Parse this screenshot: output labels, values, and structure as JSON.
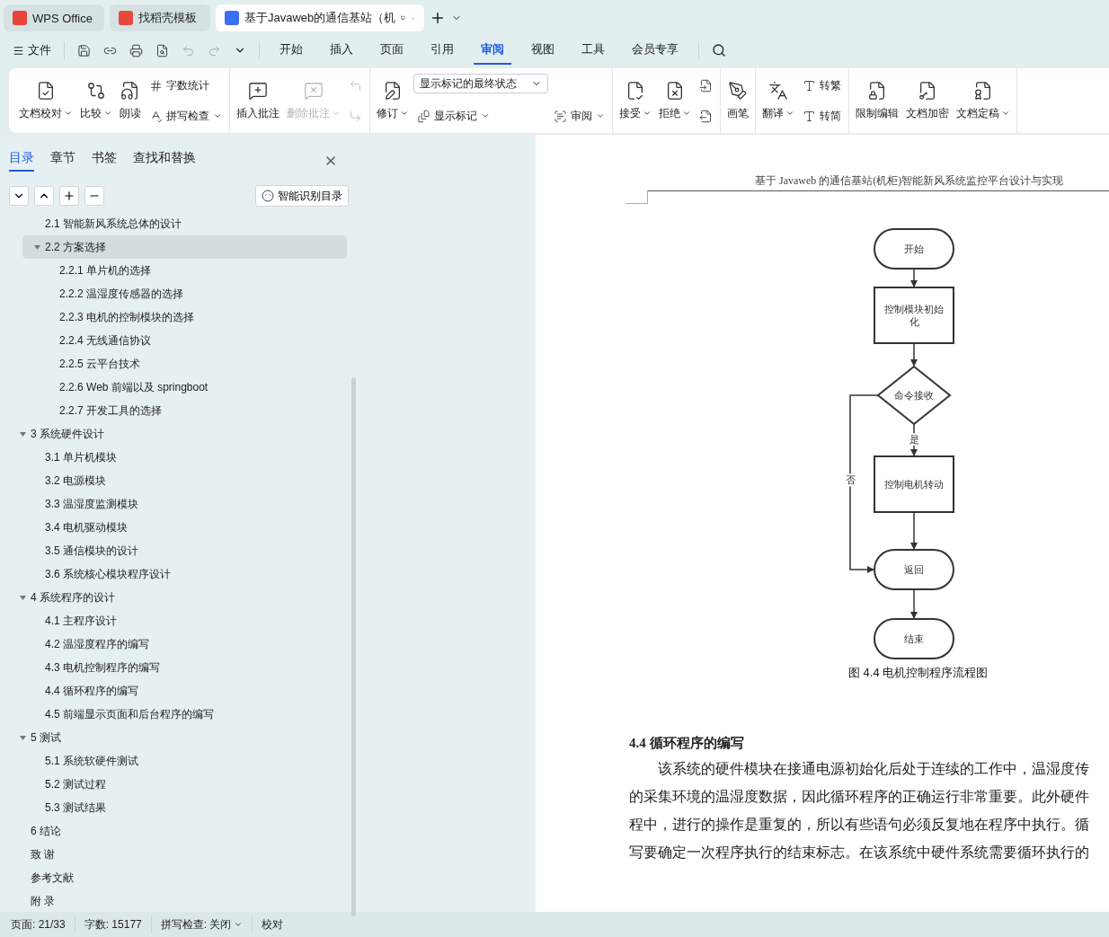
{
  "app_tabs": [
    {
      "label": "WPS Office",
      "selected": false
    },
    {
      "label": "找稻壳模板",
      "selected": false
    },
    {
      "label": "基于Javaweb的通信基站（机",
      "selected": true
    }
  ],
  "menu": {
    "file": "文件",
    "tabs": [
      {
        "label": "开始",
        "selected": false
      },
      {
        "label": "插入",
        "selected": false
      },
      {
        "label": "页面",
        "selected": false
      },
      {
        "label": "引用",
        "selected": false
      },
      {
        "label": "审阅",
        "selected": true
      },
      {
        "label": "视图",
        "selected": false
      },
      {
        "label": "工具",
        "selected": false
      },
      {
        "label": "会员专享",
        "selected": false
      }
    ]
  },
  "ribbon": [
    {
      "columns": [
        [
          {
            "kind": "large",
            "label": "文档校对",
            "dropdown": true,
            "disabled": false
          }
        ],
        [
          {
            "kind": "large",
            "label": "比较",
            "dropdown": true,
            "disabled": false
          }
        ],
        [
          {
            "kind": "large",
            "label": "朗读",
            "dropdown": false,
            "disabled": false
          }
        ],
        [
          {
            "kind": "small",
            "label": "字数统计",
            "dropdown": false,
            "disabled": false
          },
          {
            "kind": "small",
            "label": "拼写检查",
            "dropdown": true,
            "disabled": false
          }
        ]
      ]
    },
    {
      "columns": [
        [
          {
            "kind": "large",
            "label": "插入批注",
            "dropdown": false,
            "disabled": false
          }
        ],
        [
          {
            "kind": "large",
            "label": "删除批注",
            "dropdown": true,
            "disabled": true
          }
        ],
        [
          {
            "kind": "icon",
            "disabled": true
          },
          {
            "kind": "icon",
            "disabled": true
          }
        ]
      ]
    },
    {
      "columns": [
        [
          {
            "kind": "large",
            "label": "修订",
            "dropdown": true,
            "disabled": false
          }
        ],
        [
          {
            "kind": "select",
            "value": "显示标记的最终状态"
          },
          {
            "kind": "small",
            "label": "显示标记",
            "dropdown": true,
            "disabled": false
          }
        ],
        [
          {
            "kind": "spacer"
          },
          {
            "kind": "small",
            "label": "审阅",
            "dropdown": true,
            "disabled": false
          }
        ]
      ]
    },
    {
      "columns": [
        [
          {
            "kind": "large",
            "label": "接受",
            "dropdown": true,
            "disabled": false
          }
        ],
        [
          {
            "kind": "large",
            "label": "拒绝",
            "dropdown": true,
            "disabled": false
          }
        ],
        [
          {
            "kind": "icon",
            "disabled": false
          },
          {
            "kind": "icon",
            "disabled": false
          }
        ]
      ]
    },
    {
      "columns": [
        [
          {
            "kind": "large",
            "label": "画笔",
            "dropdown": false,
            "disabled": false
          }
        ]
      ]
    },
    {
      "columns": [
        [
          {
            "kind": "large",
            "label": "翻译",
            "dropdown": true,
            "disabled": false
          }
        ],
        [
          {
            "kind": "small",
            "label": "转繁",
            "dropdown": false,
            "disabled": false
          },
          {
            "kind": "small",
            "label": "转简",
            "dropdown": false,
            "disabled": false
          }
        ]
      ]
    },
    {
      "columns": [
        [
          {
            "kind": "large",
            "label": "限制编辑",
            "dropdown": false,
            "disabled": false
          }
        ],
        [
          {
            "kind": "large",
            "label": "文档加密",
            "dropdown": false,
            "disabled": false
          }
        ],
        [
          {
            "kind": "large",
            "label": "文档定稿",
            "dropdown": true,
            "disabled": false
          }
        ]
      ]
    }
  ],
  "nav_panel": {
    "tabs": [
      {
        "label": "目录",
        "selected": true
      },
      {
        "label": "章节",
        "selected": false
      },
      {
        "label": "书签",
        "selected": false
      },
      {
        "label": "查找和替换",
        "selected": false
      }
    ],
    "smart_button": "智能识别目录",
    "toc_continued": [
      {
        "label": "2.1  智能新风系统总体的设计",
        "selected": false
      },
      {
        "label": "2.2  方案选择",
        "selected": true,
        "expanded": true,
        "children": [
          {
            "label": "2.2.1  单片机的选择",
            "selected": false
          },
          {
            "label": "2.2.2  温湿度传感器的选择",
            "selected": false
          },
          {
            "label": "2.2.3  电机的控制模块的选择",
            "selected": false
          },
          {
            "label": "2.2.4  无线通信协议",
            "selected": false
          },
          {
            "label": "2.2.5 云平台技术",
            "selected": false
          },
          {
            "label": "2.2.6 Web 前端以及 springboot",
            "selected": false
          },
          {
            "label": "2.2.7  开发工具的选择",
            "selected": false
          }
        ]
      }
    ],
    "toc": [
      {
        "label": "3  系统硬件设计",
        "selected": false,
        "expanded": true,
        "children": [
          {
            "label": "3.1  单片机模块",
            "selected": false
          },
          {
            "label": "3.2  电源模块",
            "selected": false
          },
          {
            "label": "3.3  温湿度监测模块",
            "selected": false
          },
          {
            "label": "3.4  电机驱动模块",
            "selected": false
          },
          {
            "label": "3.5  通信模块的设计",
            "selected": false
          },
          {
            "label": "3.6  系统核心模块程序设计",
            "selected": false
          }
        ]
      },
      {
        "label": "4  系统程序的设计",
        "selected": false,
        "expanded": true,
        "children": [
          {
            "label": "4.1  主程序设计",
            "selected": false
          },
          {
            "label": "4.2  温湿度程序的编写",
            "selected": false
          },
          {
            "label": "4.3  电机控制程序的编写",
            "selected": false
          },
          {
            "label": "4.4  循环程序的编写",
            "selected": false
          },
          {
            "label": "4.5  前端显示页面和后台程序的编写",
            "selected": false
          }
        ]
      },
      {
        "label": "5  测试",
        "selected": false,
        "expanded": true,
        "children": [
          {
            "label": "5.1  系统软硬件测试",
            "selected": false
          },
          {
            "label": "5.2  测试过程",
            "selected": false
          },
          {
            "label": "5.3  测试结果",
            "selected": false
          }
        ]
      },
      {
        "label": "6  结论",
        "selected": false
      },
      {
        "label": "致  谢",
        "selected": false
      },
      {
        "label": "参考文献",
        "selected": false
      },
      {
        "label": "附  录",
        "selected": false
      }
    ]
  },
  "document": {
    "header": "基于 Javaweb 的通信基站(机柜)智能新风系统监控平台设计与实现",
    "flowchart": {
      "nodes": [
        {
          "kind": "terminal",
          "label": "开始"
        },
        {
          "kind": "process",
          "label": "控制模块初始化"
        },
        {
          "kind": "decision",
          "label": "命令接收"
        },
        {
          "kind": "process",
          "label": "控制电机转动"
        },
        {
          "kind": "terminal",
          "label": "返回"
        },
        {
          "kind": "terminal",
          "label": "结束"
        }
      ],
      "yes_label": "是",
      "no_label": "否"
    },
    "caption": "图 4.4  电机控制程序流程图",
    "heading": "4.4  循环程序的编写",
    "paragraph_lines": [
      "该系统的硬件模块在接通电源初始化后处于连续的工作中，温湿度传",
      "的采集环境的温湿度数据，因此循环程序的正确运行非常重要。此外硬件",
      "程中，进行的操作是重复的，所以有些语句必须反复地在程序中执行。循",
      "写要确定一次程序执行的结束标志。在该系统中硬件系统需要循环执行的"
    ]
  },
  "status_bar": {
    "page": "页面: 21/33",
    "words": "字数: 15177",
    "spell": "拼写检查: 关闭",
    "proof": "校对"
  }
}
